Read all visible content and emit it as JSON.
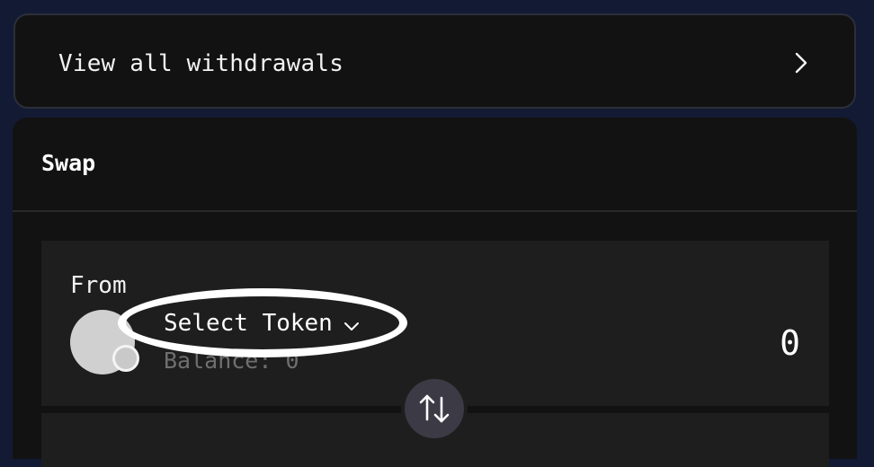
{
  "withdrawals": {
    "label": "View all withdrawals",
    "icon": "chevron-right-icon"
  },
  "swap": {
    "title": "Swap",
    "from": {
      "label": "From",
      "token_label": "Select Token",
      "dropdown_icon": "chevron-down-icon",
      "balance": "Balance: 0",
      "amount": "0"
    },
    "toggle_icon": "swap-arrows-icon"
  },
  "colors": {
    "page_background": "#131a33",
    "card_background": "#121212",
    "panel_background": "#1e1e1e",
    "muted_text": "#6f6f6f",
    "toggle_background": "#3b3a45",
    "highlight": "#ffffff"
  }
}
